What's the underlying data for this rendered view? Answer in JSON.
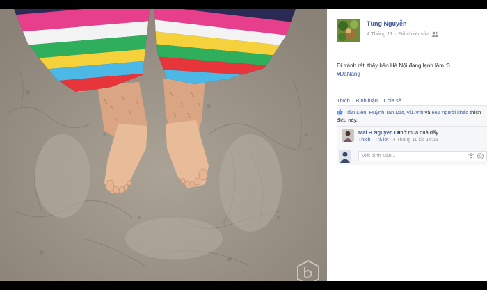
{
  "post": {
    "author": "Tùng Nguyễn",
    "date": "4 Tháng 11",
    "separator": "·",
    "edited": "Đã chỉnh sửa",
    "privacy_icon": "friends-icon",
    "text": "Đi tránh rét, thấy bảo Hà Nội đang lạnh lắm :3",
    "hashtag": "#DaNang"
  },
  "actions": {
    "like": "Thích",
    "comment": "Bình luận",
    "share": "Chia sẻ",
    "dot": "·"
  },
  "likes": {
    "icon": "thumbs-up-icon",
    "names": "Trần Liên, Huỳnh Tan Dat, Vũ Anh",
    "and": "và",
    "others": "665 người khác",
    "suffix": "thích điều này."
  },
  "comment": {
    "name": "Mai H Nguyen Le",
    "text": "Nhớ mua quà đấy",
    "like": "Thích",
    "reply": "Trả lời",
    "time": "4 Tháng 11 lúc 14:23",
    "dot": "·"
  },
  "composer": {
    "placeholder": "Viết bình luận...",
    "camera_icon": "camera-icon",
    "emoji_icon": "emoji-icon"
  },
  "colors": {
    "link": "#3b5998",
    "muted": "#90949c",
    "sand": "#9e958a"
  }
}
